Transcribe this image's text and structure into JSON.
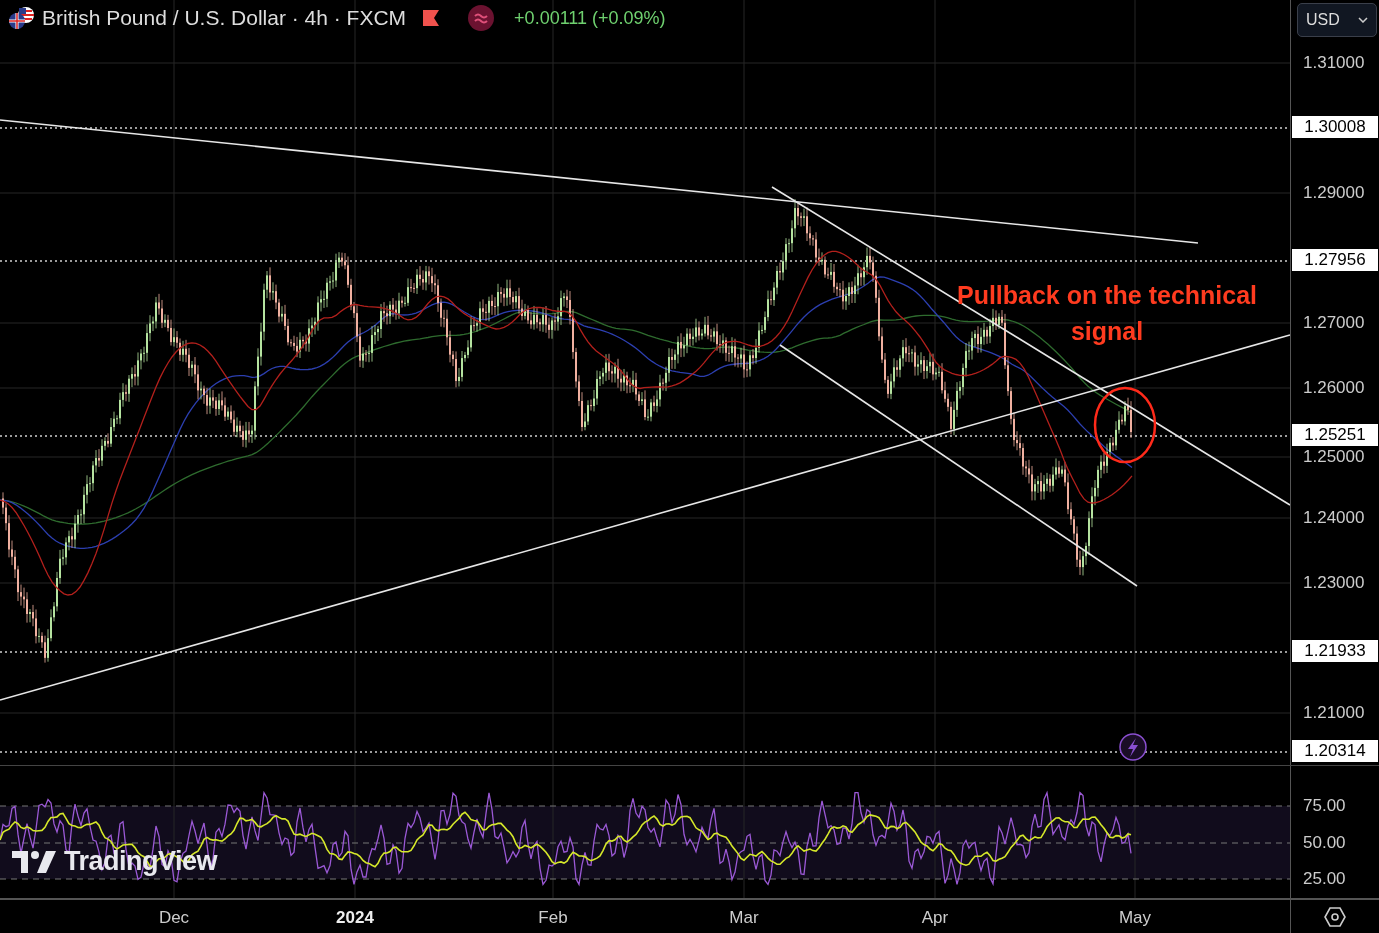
{
  "header": {
    "symbol": "British Pound / U.S. Dollar · 4h · FXCM",
    "change": "+0.00111 (+0.09%)"
  },
  "currency_select": {
    "value": "USD"
  },
  "price_axis": {
    "ticks": [
      "1.31000",
      "1.29000",
      "1.27000",
      "1.26000",
      "1.25000",
      "1.24000",
      "1.23000",
      "1.21000"
    ],
    "levels": [
      "1.30008",
      "1.27956",
      "1.25251",
      "1.21933",
      "1.20314"
    ]
  },
  "annotation": {
    "text": "Pullback on the technical signal"
  },
  "watermark_logo": {
    "text": "TradingView"
  },
  "rsi_axis": {
    "ticks": [
      "75.00",
      "50.00",
      "25.00"
    ]
  },
  "time_axis": {
    "labels": [
      {
        "label": "Dec",
        "bold": false
      },
      {
        "label": "2024",
        "bold": true
      },
      {
        "label": "Feb",
        "bold": false
      },
      {
        "label": "Mar",
        "bold": false
      },
      {
        "label": "Apr",
        "bold": false
      },
      {
        "label": "May",
        "bold": false
      }
    ]
  }
}
